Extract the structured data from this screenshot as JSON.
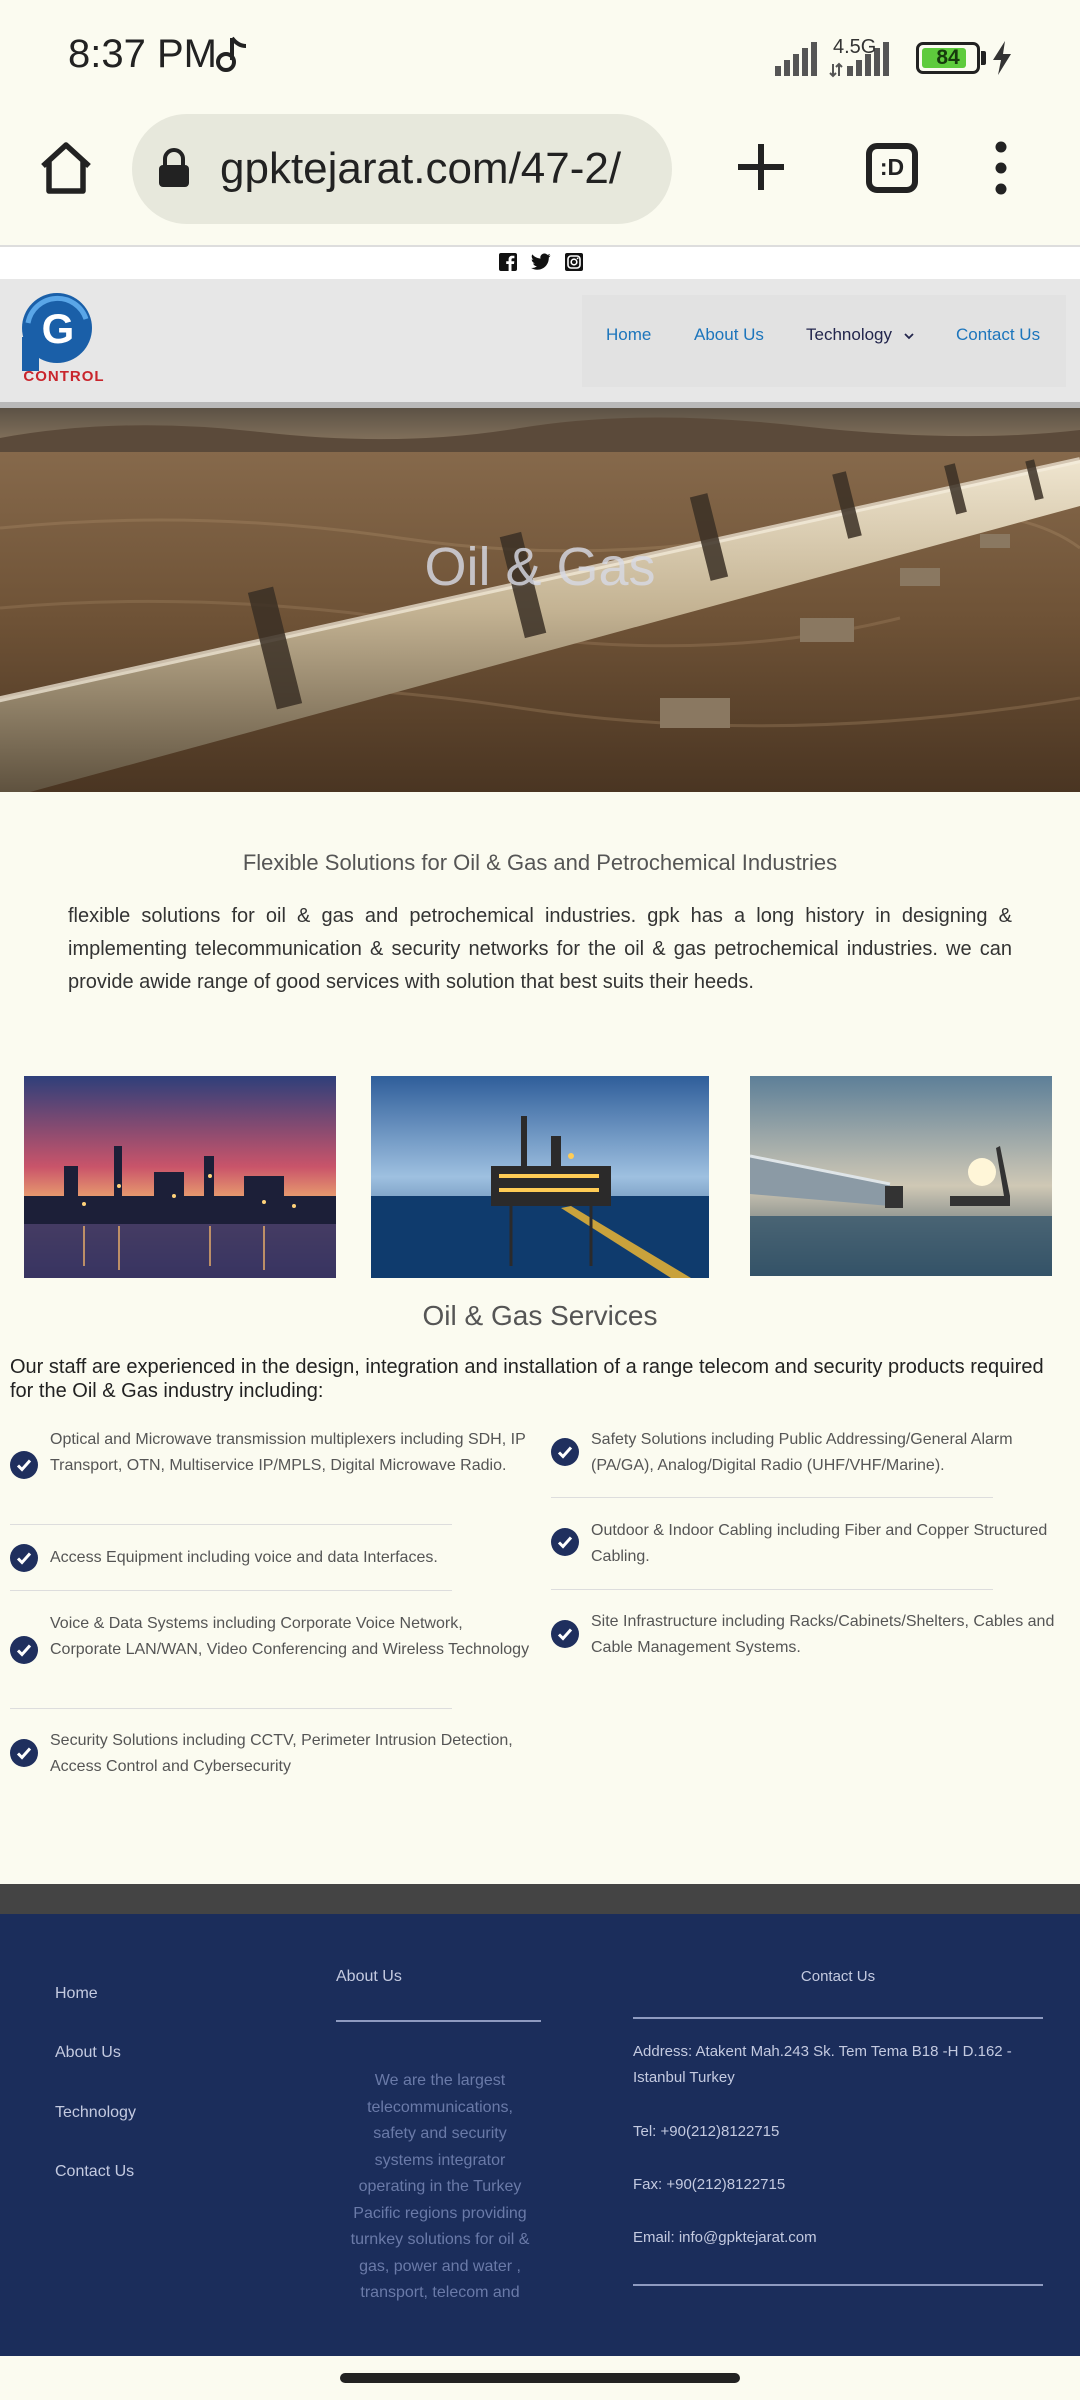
{
  "status_bar": {
    "time": "8:37 PM",
    "network": "4.5G",
    "battery_level": "84",
    "battery_fraction": 0.84,
    "icons": [
      "music-note-icon",
      "signal-icon",
      "signal-icon",
      "battery-icon",
      "charging-bolt-icon"
    ]
  },
  "browser": {
    "url": "gpktejarat.com/47-2/",
    "tabs_label": ":D",
    "icons": [
      "home-icon",
      "lock-icon",
      "plus-icon",
      "tab-switcher-icon",
      "overflow-menu-icon"
    ]
  },
  "social": {
    "icons": [
      "facebook-icon",
      "twitter-icon",
      "instagram-icon"
    ]
  },
  "site_header": {
    "logo_text": "CONTROL",
    "logo_letter": "G",
    "nav": {
      "home": "Home",
      "about": "About Us",
      "technology": "Technology",
      "contact": "Contact Us"
    }
  },
  "hero": {
    "title": "Oil & Gas"
  },
  "intro": {
    "heading": "Flexible Solutions for Oil & Gas and Petrochemical Industries",
    "text": "flexible solutions for oil & gas and petrochemical industries. gpk has a long history in designing & implementing telecommunication & security networks for the oil & gas petrochemical industries. we can provide awide range of good services with solution that best suits their heeds."
  },
  "services": {
    "title": "Oil & Gas Services",
    "intro": "Our staff are experienced in the design, integration and installation of a range telecom and security products required for the Oil & Gas industry including:",
    "left": [
      "Optical and Microwave transmission multiplexers including SDH, IP Transport, OTN, Multiservice IP/MPLS, Digital Microwave Radio.",
      "Access Equipment including voice and data Interfaces.",
      "Voice & Data Systems including Corporate Voice Network, Corporate LAN/WAN, Video Conferencing and Wireless Technology",
      "Security Solutions including CCTV, Perimeter Intrusion Detection, Access Control and Cybersecurity"
    ],
    "right": [
      "Safety Solutions including Public Addressing/General Alarm (PA/GA), Analog/Digital Radio (UHF/VHF/Marine).",
      "Outdoor & Indoor Cabling including Fiber and Copper Structured Cabling.",
      "Site Infrastructure including Racks/Cabinets/Shelters, Cables and Cable Management Systems."
    ]
  },
  "footer": {
    "links": {
      "home": "Home",
      "about": "About Us",
      "technology": "Technology",
      "contact": "Contact Us"
    },
    "about_title": "About Us",
    "about_text": "We are the largest telecommunications, safety and security systems integrator operating in the Turkey Pacific regions providing turnkey solutions for oil & gas, power and water , transport, telecom and",
    "contact_title": "Contact Us",
    "address": "Address: Atakent Mah.243 Sk. Tem Tema B18 -H D.162 - Istanbul Turkey",
    "tel": "Tel: +90(212)8122715",
    "fax": "Fax: +90(212)8122715",
    "email": "Email: info@gpktejarat.com"
  },
  "colors": {
    "accent": "#1c75bc",
    "nav_active": "#23264d",
    "check": "#1f2f5e",
    "footer": "#1b2d5b",
    "battery": "#5ecb3c"
  }
}
